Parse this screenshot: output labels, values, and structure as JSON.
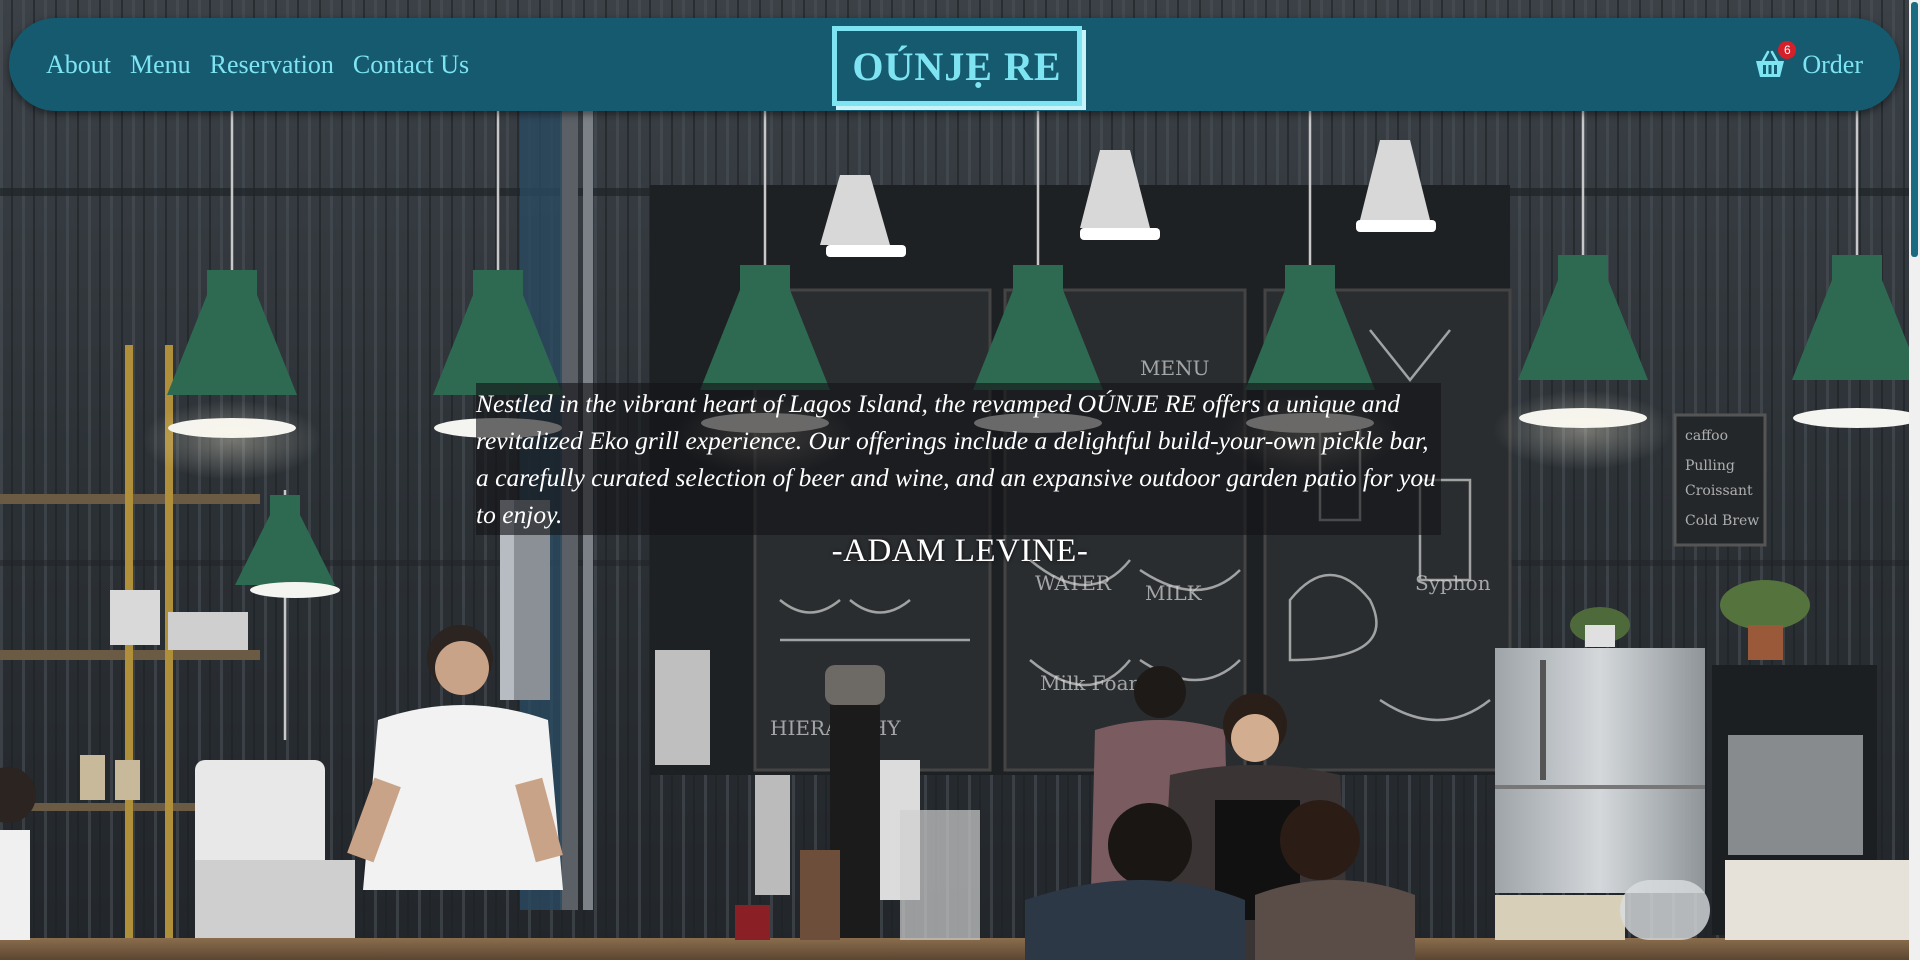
{
  "nav": {
    "links": [
      "About",
      "Menu",
      "Reservation",
      "Contact Us"
    ],
    "order_label": "Order",
    "cart_count": "6"
  },
  "brand": {
    "logo_text": "OÚNJẸ RE"
  },
  "hero": {
    "quote": "Nestled in the vibrant heart of Lagos Island, the revamped OÚNJE RE offers a unique and revitalized Eko grill experience. Our offerings include a delightful build-your-own pickle bar, a carefully curated selection of beer and wine, and an expansive outdoor garden patio for you to enjoy.",
    "author": "-ADAM LEVINE-"
  },
  "colors": {
    "nav_background": "#155a6f",
    "accent": "#7ee4f2",
    "badge": "#d4202a"
  },
  "icons": {
    "cart": "shopping-basket-icon"
  }
}
